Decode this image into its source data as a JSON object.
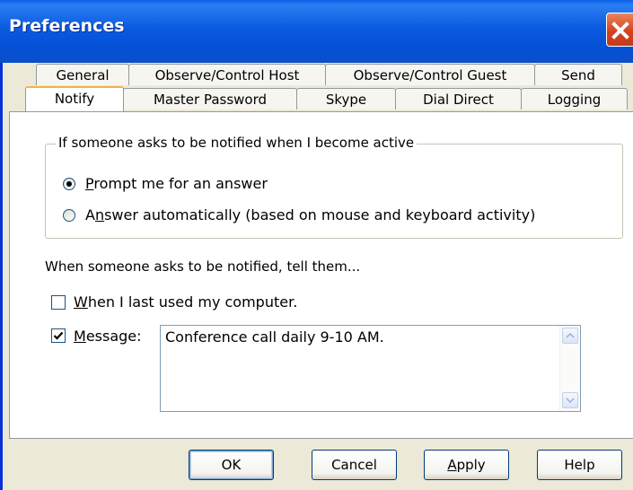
{
  "window": {
    "title": "Preferences",
    "close_icon": "close-icon"
  },
  "tabs_row1": [
    "General",
    "Observe/Control Host",
    "Observe/Control Guest",
    "Send"
  ],
  "tabs_row2": [
    "Notify",
    "Master Password",
    "Skype",
    "Dial Direct",
    "Logging"
  ],
  "active_tab": "Notify",
  "group": {
    "legend": "If someone asks to be notified when I become active",
    "options": [
      {
        "label": "Prompt me for an answer",
        "selected": true
      },
      {
        "label": "Answer automatically (based on mouse and keyboard activity)",
        "selected": false
      }
    ]
  },
  "tell_them_label": "When someone asks to be notified, tell them...",
  "last_used": {
    "label": "When I last used my computer.",
    "checked": false
  },
  "message": {
    "label": "Message:",
    "checked": true,
    "value": "Conference call daily 9-10 AM."
  },
  "buttons": {
    "ok": "OK",
    "cancel": "Cancel",
    "apply": "Apply",
    "help": "Help"
  },
  "colors": {
    "title_bar": "#0a5fe6",
    "close_button": "#d5431f",
    "dialog_bg": "#ece9d8"
  }
}
